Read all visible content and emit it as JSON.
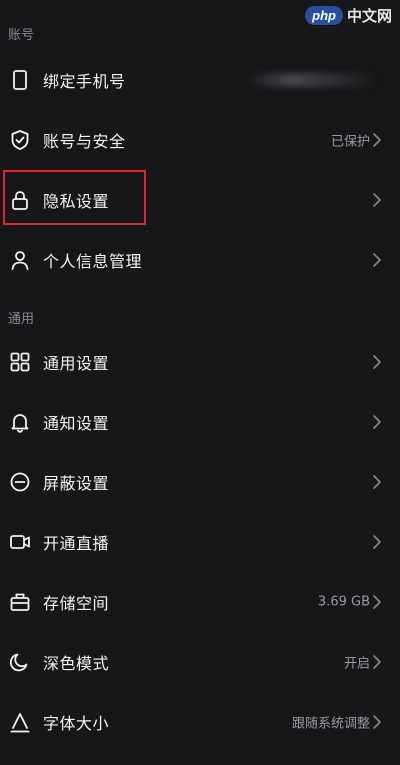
{
  "watermark": {
    "logo": "php",
    "text": "中文网"
  },
  "sections": {
    "account": {
      "header": "账号",
      "items": [
        {
          "label": "绑定手机号",
          "icon": "phone-icon",
          "value": ""
        },
        {
          "label": "账号与安全",
          "icon": "shield-check-icon",
          "value": "已保护"
        },
        {
          "label": "隐私设置",
          "icon": "lock-icon",
          "value": ""
        },
        {
          "label": "个人信息管理",
          "icon": "person-icon",
          "value": ""
        }
      ]
    },
    "general": {
      "header": "通用",
      "items": [
        {
          "label": "通用设置",
          "icon": "grid-icon",
          "value": ""
        },
        {
          "label": "通知设置",
          "icon": "bell-icon",
          "value": ""
        },
        {
          "label": "屏蔽设置",
          "icon": "block-icon",
          "value": ""
        },
        {
          "label": "开通直播",
          "icon": "video-camera-icon",
          "value": ""
        },
        {
          "label": "存储空间",
          "icon": "storage-icon",
          "value": "3.69 GB"
        },
        {
          "label": "深色模式",
          "icon": "moon-icon",
          "value": "开启"
        },
        {
          "label": "字体大小",
          "icon": "font-size-icon",
          "value": "跟随系统调整"
        }
      ]
    }
  },
  "colors": {
    "background": "#161719",
    "highlight_box": "#e0262d",
    "secondary_text": "#9a9b9f"
  }
}
